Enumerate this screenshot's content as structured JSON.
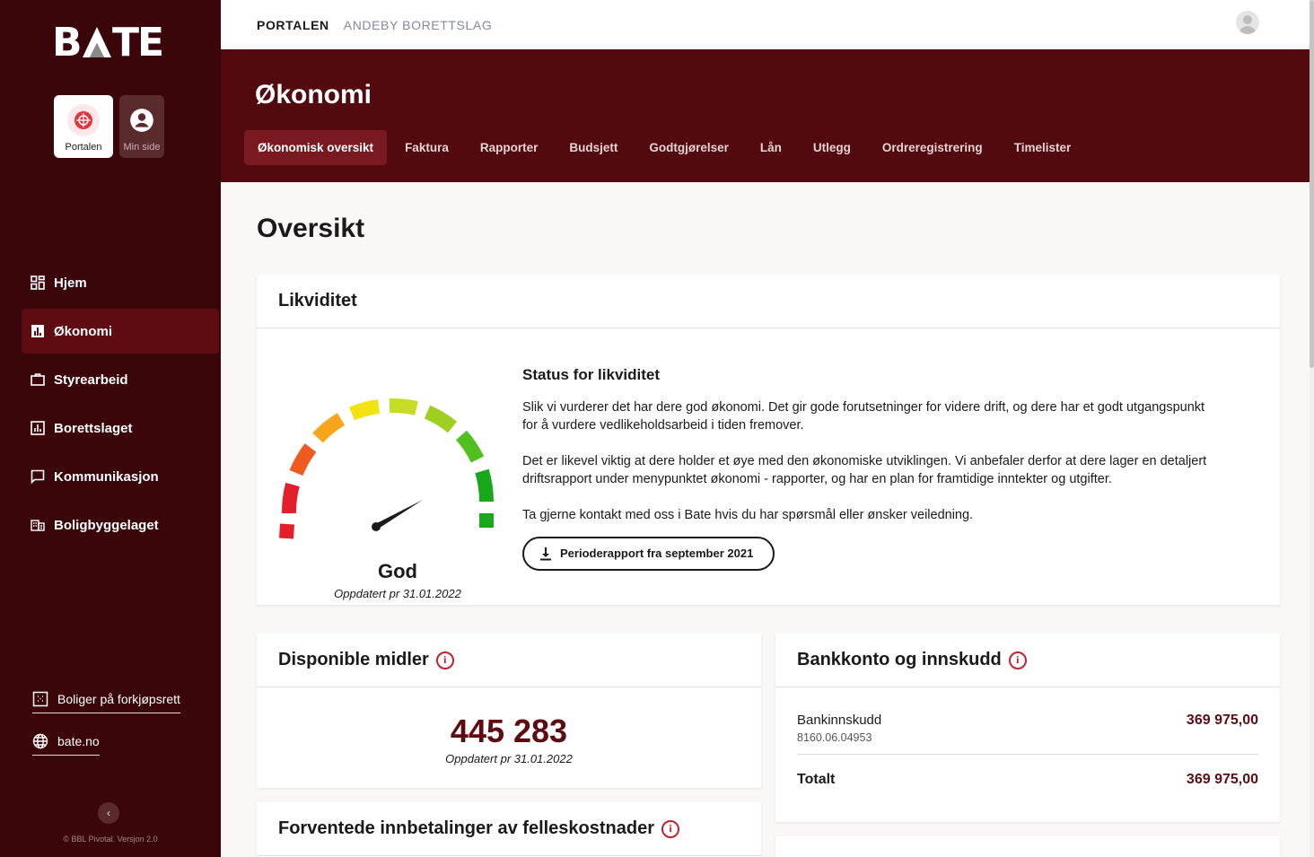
{
  "sidebar": {
    "logo": "BATE",
    "tiles": [
      {
        "label": "Portalen",
        "icon": "portal-icon",
        "active": true
      },
      {
        "label": "Min side",
        "icon": "user-circle-icon",
        "active": false
      }
    ],
    "nav": [
      {
        "label": "Hjem",
        "icon": "grid-icon",
        "active": false
      },
      {
        "label": "Økonomi",
        "icon": "bar-chart-icon",
        "active": true
      },
      {
        "label": "Styrearbeid",
        "icon": "briefcase-icon",
        "active": false
      },
      {
        "label": "Borettslaget",
        "icon": "chart-box-icon",
        "active": false
      },
      {
        "label": "Kommunikasjon",
        "icon": "chat-icon",
        "active": false
      },
      {
        "label": "Boligbyggelaget",
        "icon": "building-icon",
        "active": false
      }
    ],
    "links": [
      {
        "label": "Boliger på forkjøpsrett",
        "icon": "dotted-square-icon"
      },
      {
        "label": "bate.no",
        "icon": "globe-icon"
      }
    ],
    "copyright": "© BBL Pivotal. Versjon 2.0"
  },
  "topbar": {
    "crumbs": [
      "PORTALEN",
      "ANDEBY BORETTSLAG"
    ]
  },
  "header": {
    "title": "Økonomi",
    "tabs": [
      "Økonomisk oversikt",
      "Faktura",
      "Rapporter",
      "Budsjett",
      "Godtgjørelser",
      "Lån",
      "Utlegg",
      "Ordreregistrering",
      "Timelister"
    ]
  },
  "main": {
    "title": "Oversikt",
    "liquidity": {
      "title": "Likviditet",
      "gauge_label": "God",
      "gauge_updated": "Oppdatert pr 31.01.2022",
      "status_title": "Status for likviditet",
      "p1": "Slik vi vurderer det har dere god økonomi. Det gir gode forutsetninger for videre drift, og dere har et godt utgangspunkt for å vurdere vedlikeholdsarbeid i tiden fremover.",
      "p2": "Det er likevel viktig at dere holder et øye med den økonomiske utviklingen. Vi anbefaler derfor at dere lager en detaljert driftsrapport under menypunktet økonomi - rapporter, og har en plan for framtidige inntekter og utgifter.",
      "p3": "Ta gjerne kontakt med oss i Bate hvis du har spørsmål eller ønsker veiledning.",
      "button": "Perioderapport fra september 2021"
    },
    "available": {
      "title": "Disponible midler",
      "value": "445 283",
      "updated": "Oppdatert pr 31.01.2022"
    },
    "bank": {
      "title": "Bankkonto og innskudd",
      "row_label": "Bankinnskudd",
      "row_account": "8160.06.04953",
      "row_amount": "369 975,00",
      "total_label": "Totalt",
      "total_amount": "369 975,00"
    },
    "expected": {
      "title": "Forventede innbetalinger av felleskostnader"
    }
  },
  "colors": {
    "sidebar": "#3a0609",
    "header": "#520a0f",
    "accent": "#5e0b11",
    "info": "#c0232e"
  }
}
